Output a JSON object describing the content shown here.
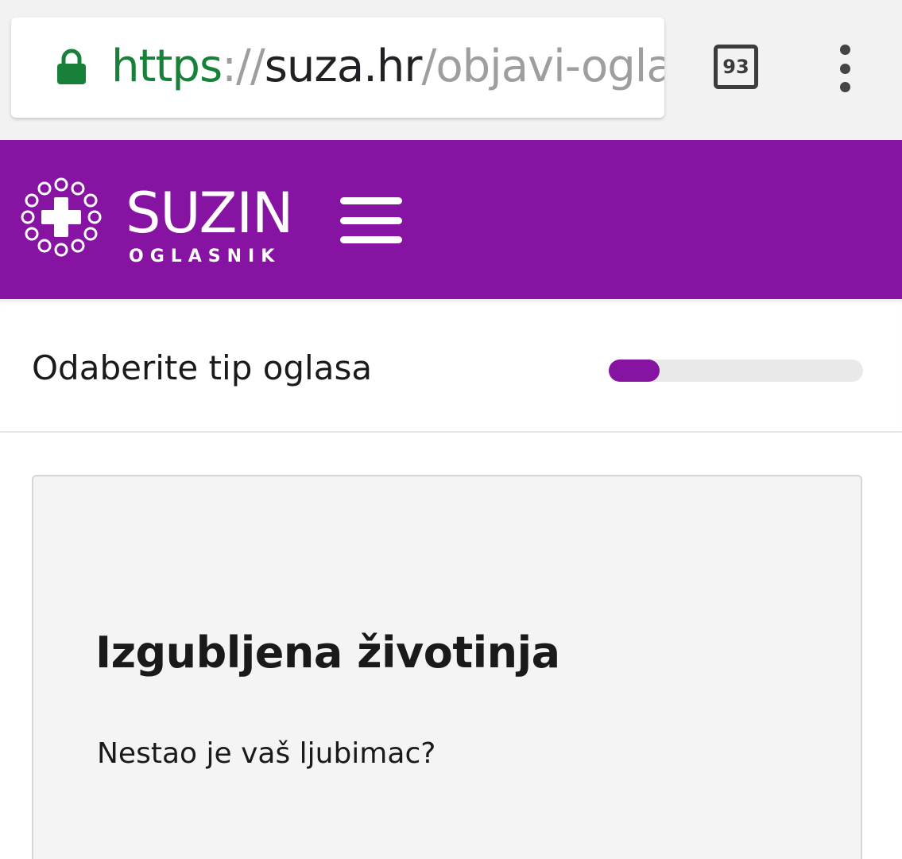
{
  "browser": {
    "url": {
      "scheme": "https",
      "separator": "://",
      "host": "suza.hr",
      "path": "/objavi-ogla"
    },
    "tab_count": "93",
    "icons": {
      "lock": "lock-icon",
      "tabs": "tab-switcher-icon",
      "menu": "more-vert-icon"
    },
    "colors": {
      "secure": "#188038"
    }
  },
  "header": {
    "brand_name": "SUZIN",
    "brand_sub": "OGLASNIK",
    "icons": {
      "logo": "cross-logo-icon",
      "menu": "hamburger-icon"
    },
    "colors": {
      "background": "#8613a1"
    }
  },
  "step": {
    "title": "Odaberite tip oglasa",
    "progress_fraction": 0.2,
    "colors": {
      "progress": "#8613a1",
      "track": "#e9e9e9"
    }
  },
  "card": {
    "title": "Izgubljena životinja",
    "description": "Nestao je vaš ljubimac?"
  }
}
